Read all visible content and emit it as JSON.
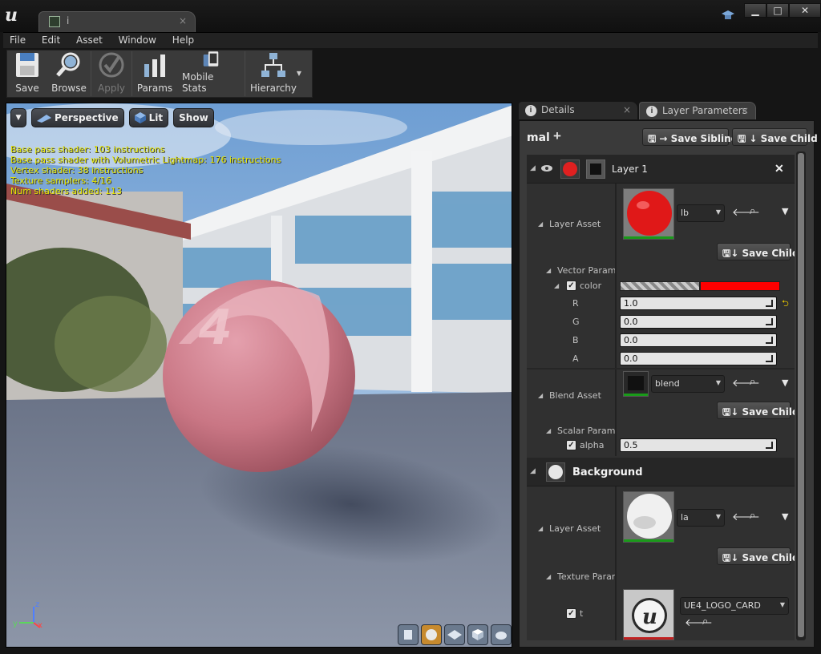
{
  "window": {
    "tab_title": "i",
    "tab_close": "×",
    "controls": {
      "minimize": "▁",
      "maximize": "□",
      "close": "✕"
    }
  },
  "menu": [
    "File",
    "Edit",
    "Asset",
    "Window",
    "Help"
  ],
  "toolbar": [
    {
      "label": "Save",
      "icon": "save-icon",
      "enabled": true
    },
    {
      "label": "Browse",
      "icon": "browse-icon",
      "enabled": true
    },
    {
      "label": "Apply",
      "icon": "apply-icon",
      "enabled": false
    },
    {
      "label": "Params",
      "icon": "params-icon",
      "enabled": true
    },
    {
      "label": "Mobile Stats",
      "icon": "mobile-stats-icon",
      "enabled": true
    },
    {
      "label": "Hierarchy",
      "icon": "hierarchy-icon",
      "enabled": true
    }
  ],
  "viewport": {
    "perspective": "Perspective",
    "lit": "Lit",
    "show": "Show",
    "stats": [
      "Base pass shader: 103 instructions",
      "Base pass shader with Volumetric Lightmap: 176 instructions",
      "Vertex shader: 38 instructions",
      "Texture samplers: 4/16",
      "Num shaders added: 113"
    ],
    "stats_color": "#e6e600",
    "axis": {
      "x": "x",
      "y": "y",
      "z": "z"
    }
  },
  "panel": {
    "tabs": [
      {
        "label": "Details"
      },
      {
        "label": "Layer Parameters"
      }
    ],
    "material_name": "mal",
    "add": "+",
    "save_sibling": "Save Sibling",
    "save_child": "Save Child"
  },
  "layer1": {
    "title": "Layer 1",
    "close": "✕",
    "layer_asset_label": "Layer Asset",
    "layer_asset_value": "lb",
    "save_child": "Save Child",
    "vector_group": "Vector Parame",
    "color_label": "color",
    "color_value": "#ff0000",
    "channels": [
      {
        "label": "R",
        "value": "1.0"
      },
      {
        "label": "G",
        "value": "0.0"
      },
      {
        "label": "B",
        "value": "0.0"
      },
      {
        "label": "A",
        "value": "0.0"
      }
    ],
    "blend_asset_label": "Blend Asset",
    "blend_asset_value": "blend",
    "blend_save_child": "Save Child",
    "scalar_group": "Scalar Parame",
    "alpha_label": "alpha",
    "alpha_value": "0.5"
  },
  "background": {
    "title": "Background",
    "layer_asset_label": "Layer Asset",
    "layer_asset_value": "la",
    "save_child": "Save Child",
    "texture_group": "Texture Paran",
    "texture_param_label": "t",
    "texture_value": "UE4_LOGO_CARD"
  }
}
